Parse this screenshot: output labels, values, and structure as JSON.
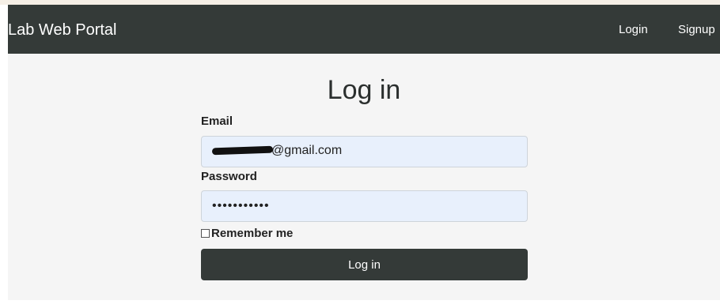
{
  "navbar": {
    "brand": "Lab Web Portal",
    "links": {
      "login": "Login",
      "signup": "Signup"
    },
    "background": "#343a38"
  },
  "form": {
    "title": "Log in",
    "email": {
      "label": "Email",
      "value": "██████████@gmail.com"
    },
    "password": {
      "label": "Password",
      "value": "•••••••••••"
    },
    "remember": {
      "label": "Remember me",
      "checked": false
    },
    "submit_label": "Log in",
    "input_background": "#e8f0fc"
  }
}
